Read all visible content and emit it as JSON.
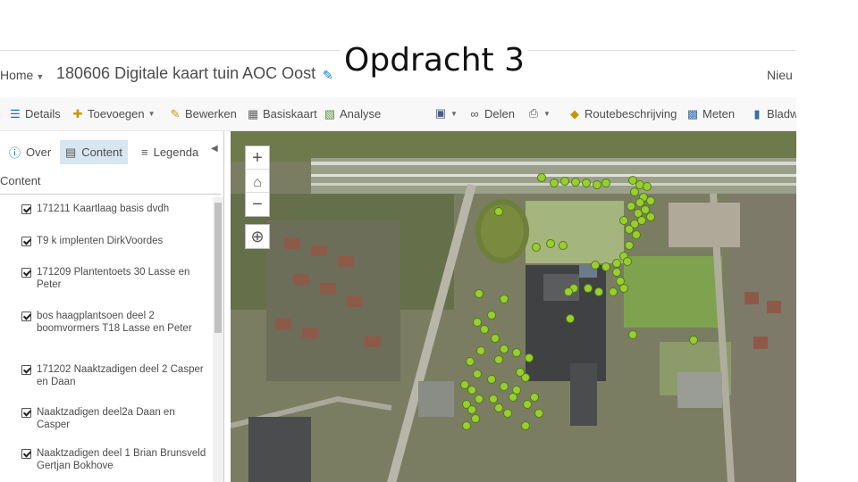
{
  "slide": {
    "title": "Opdracht 3"
  },
  "header": {
    "home_label": "Home",
    "map_title": "180606 Digitale kaart tuin AOC Oost",
    "new_label": "Nieu"
  },
  "toolbar": {
    "details": "Details",
    "add": "Toevoegen",
    "edit": "Bewerken",
    "basemap": "Basiskaart",
    "analysis": "Analyse",
    "share": "Delen",
    "directions": "Routebeschrijving",
    "measure": "Meten",
    "bookmarks": "Bladw"
  },
  "panel": {
    "tabs": {
      "about": "Over",
      "content": "Content",
      "legend": "Legenda"
    },
    "content_heading": "Content",
    "layers": [
      {
        "label": "171211 Kaartlaag basis dvdh",
        "checked": true
      },
      {
        "label": "T9 k implenten DirkVoordes",
        "checked": true
      },
      {
        "label": "171209 Plantentoets 30 Lasse en Peter",
        "checked": true
      },
      {
        "label": "bos haagplantsoen deel 2 boomvormers T18 Lasse en Peter",
        "checked": true
      },
      {
        "label": "171202 Naaktzadigen deel 2 Casper en Daan",
        "checked": true
      },
      {
        "label": "Naaktzadigen deel2a Daan en Casper",
        "checked": true
      },
      {
        "label": "Naaktzadigen deel 1 Brian Brunsveld Gertjan Bokhove",
        "checked": true
      }
    ]
  },
  "colors": {
    "accent": "#0079c1",
    "marker": "#9acd32",
    "marker_edge": "#4f7f10"
  },
  "map": {
    "markers": [
      [
        348,
        52
      ],
      [
        362,
        58
      ],
      [
        374,
        56
      ],
      [
        386,
        57
      ],
      [
        398,
        58
      ],
      [
        410,
        60
      ],
      [
        420,
        58
      ],
      [
        450,
        55
      ],
      [
        458,
        60
      ],
      [
        466,
        62
      ],
      [
        452,
        68
      ],
      [
        462,
        74
      ],
      [
        470,
        78
      ],
      [
        458,
        80
      ],
      [
        448,
        84
      ],
      [
        464,
        88
      ],
      [
        456,
        92
      ],
      [
        470,
        96
      ],
      [
        460,
        100
      ],
      [
        452,
        104
      ],
      [
        440,
        100
      ],
      [
        446,
        110
      ],
      [
        454,
        116
      ],
      [
        446,
        128
      ],
      [
        440,
        140
      ],
      [
        444,
        146
      ],
      [
        432,
        148
      ],
      [
        420,
        152
      ],
      [
        408,
        150
      ],
      [
        432,
        158
      ],
      [
        436,
        168
      ],
      [
        440,
        176
      ],
      [
        428,
        180
      ],
      [
        412,
        180
      ],
      [
        400,
        176
      ],
      [
        384,
        176
      ],
      [
        378,
        180
      ],
      [
        372,
        128
      ],
      [
        358,
        126
      ],
      [
        342,
        130
      ],
      [
        300,
        90
      ],
      [
        380,
        210
      ],
      [
        400,
        176
      ],
      [
        518,
        234
      ],
      [
        450,
        228
      ],
      [
        278,
        182
      ],
      [
        306,
        188
      ],
      [
        292,
        206
      ],
      [
        276,
        214
      ],
      [
        284,
        222
      ],
      [
        296,
        232
      ],
      [
        306,
        244
      ],
      [
        280,
        246
      ],
      [
        268,
        258
      ],
      [
        300,
        256
      ],
      [
        276,
        272
      ],
      [
        292,
        278
      ],
      [
        306,
        286
      ],
      [
        320,
        290
      ],
      [
        340,
        298
      ],
      [
        330,
        276
      ],
      [
        324,
        270
      ],
      [
        334,
        254
      ],
      [
        320,
        248
      ],
      [
        262,
        284
      ],
      [
        270,
        290
      ],
      [
        278,
        300
      ],
      [
        264,
        306
      ],
      [
        270,
        312
      ],
      [
        294,
        300
      ],
      [
        300,
        310
      ],
      [
        310,
        316
      ],
      [
        316,
        298
      ],
      [
        332,
        306
      ],
      [
        345,
        316
      ],
      [
        330,
        330
      ],
      [
        274,
        322
      ],
      [
        264,
        330
      ]
    ]
  }
}
